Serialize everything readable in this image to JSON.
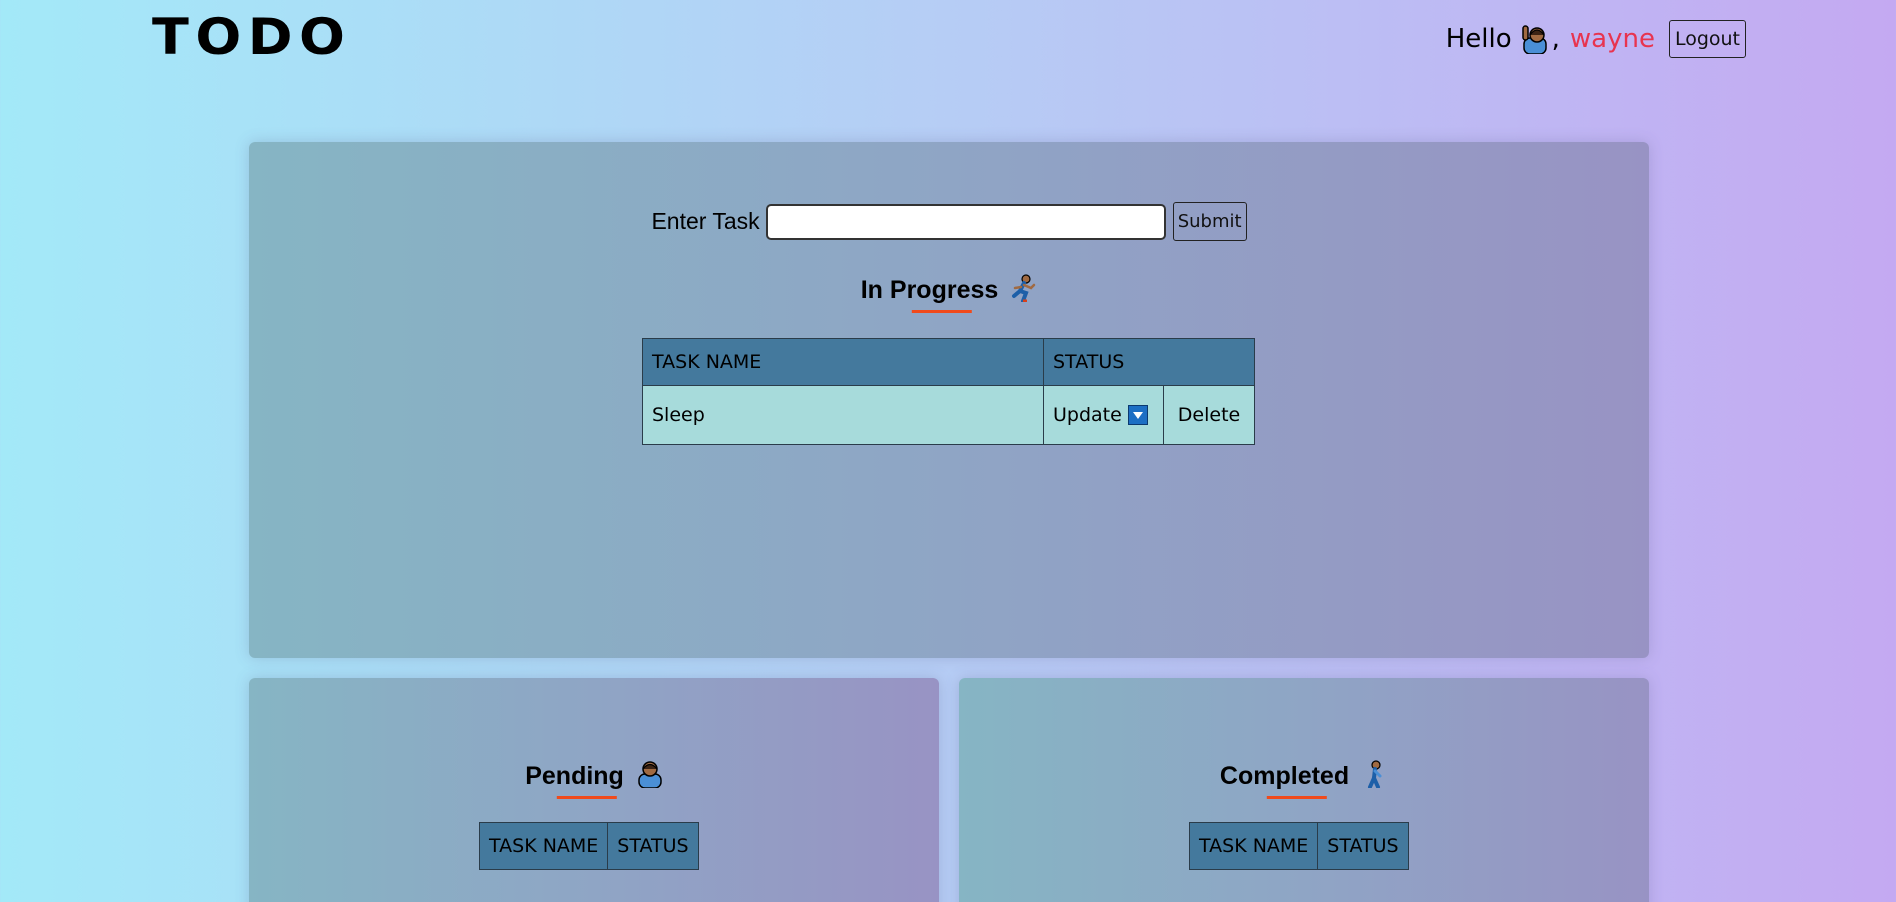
{
  "app": {
    "logo": "TODO"
  },
  "header": {
    "greeting": "Hello",
    "comma": ",",
    "username": "wayne",
    "logout_label": "Logout",
    "username_color": "#e8344f"
  },
  "form": {
    "label": "Enter Task",
    "input_value": "",
    "input_placeholder": "",
    "submit_label": "Submit"
  },
  "in_progress": {
    "title": "In Progress",
    "icon": "running-person-icon",
    "columns": [
      "TASK NAME",
      "STATUS"
    ],
    "rows": [
      {
        "task": "Sleep",
        "status_select": "Update",
        "delete_label": "Delete"
      }
    ]
  },
  "pending": {
    "title": "Pending",
    "icon": "person-icon",
    "columns": [
      "TASK NAME",
      "STATUS"
    ]
  },
  "completed": {
    "title": "Completed",
    "icon": "walking-person-icon",
    "columns": [
      "TASK NAME",
      "STATUS"
    ]
  },
  "colors": {
    "accent_underline": "#f04a1c",
    "table_header": "#44799d",
    "table_cell": "#a7dbdb",
    "select_arrow": "#1d6fc4"
  }
}
